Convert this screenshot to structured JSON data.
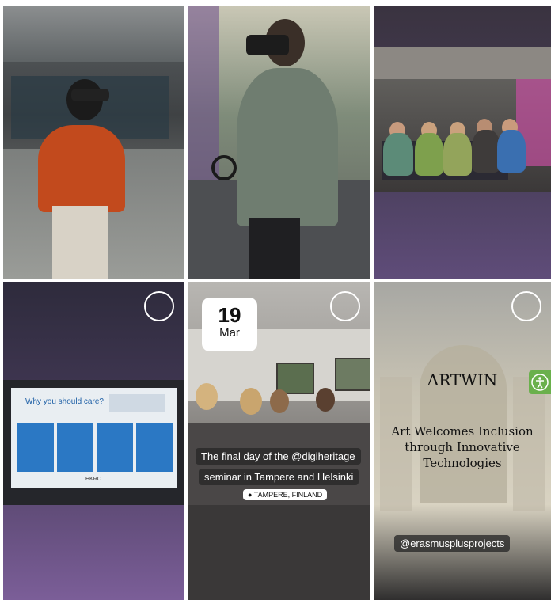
{
  "story_highlights": [
    {
      "id": "t1",
      "select_icon": null
    },
    {
      "id": "t2",
      "select_icon": null
    },
    {
      "id": "t3",
      "select_icon": null
    },
    {
      "id": "t4",
      "select_icon": "circle-select-icon",
      "slide": {
        "title": "Why you should care?",
        "footer": "HKRC"
      }
    },
    {
      "id": "t5",
      "select_icon": "circle-select-icon",
      "date": {
        "day": "19",
        "month": "Mar"
      },
      "caption_line1": "The final day of the @digiheritage",
      "caption_line2": "seminar in Tampere and Helsinki",
      "location": "TAMPERE, FINLAND"
    },
    {
      "id": "t6",
      "select_icon": "circle-select-icon",
      "title": "ARTWIN",
      "subtitle_line1": "Art Welcomes Inclusion",
      "subtitle_line2": "through Innovative",
      "subtitle_line3": "Technologies",
      "handle": "@erasmusplusprojects",
      "accessibility_icon": "accessibility-icon"
    }
  ],
  "colors": {
    "gap": "#ffffff",
    "purple_dark": "#3c3550",
    "purple_light": "#8a6aa6",
    "accent_blue": "#2b78c4",
    "access_green": "#6ab04c"
  }
}
